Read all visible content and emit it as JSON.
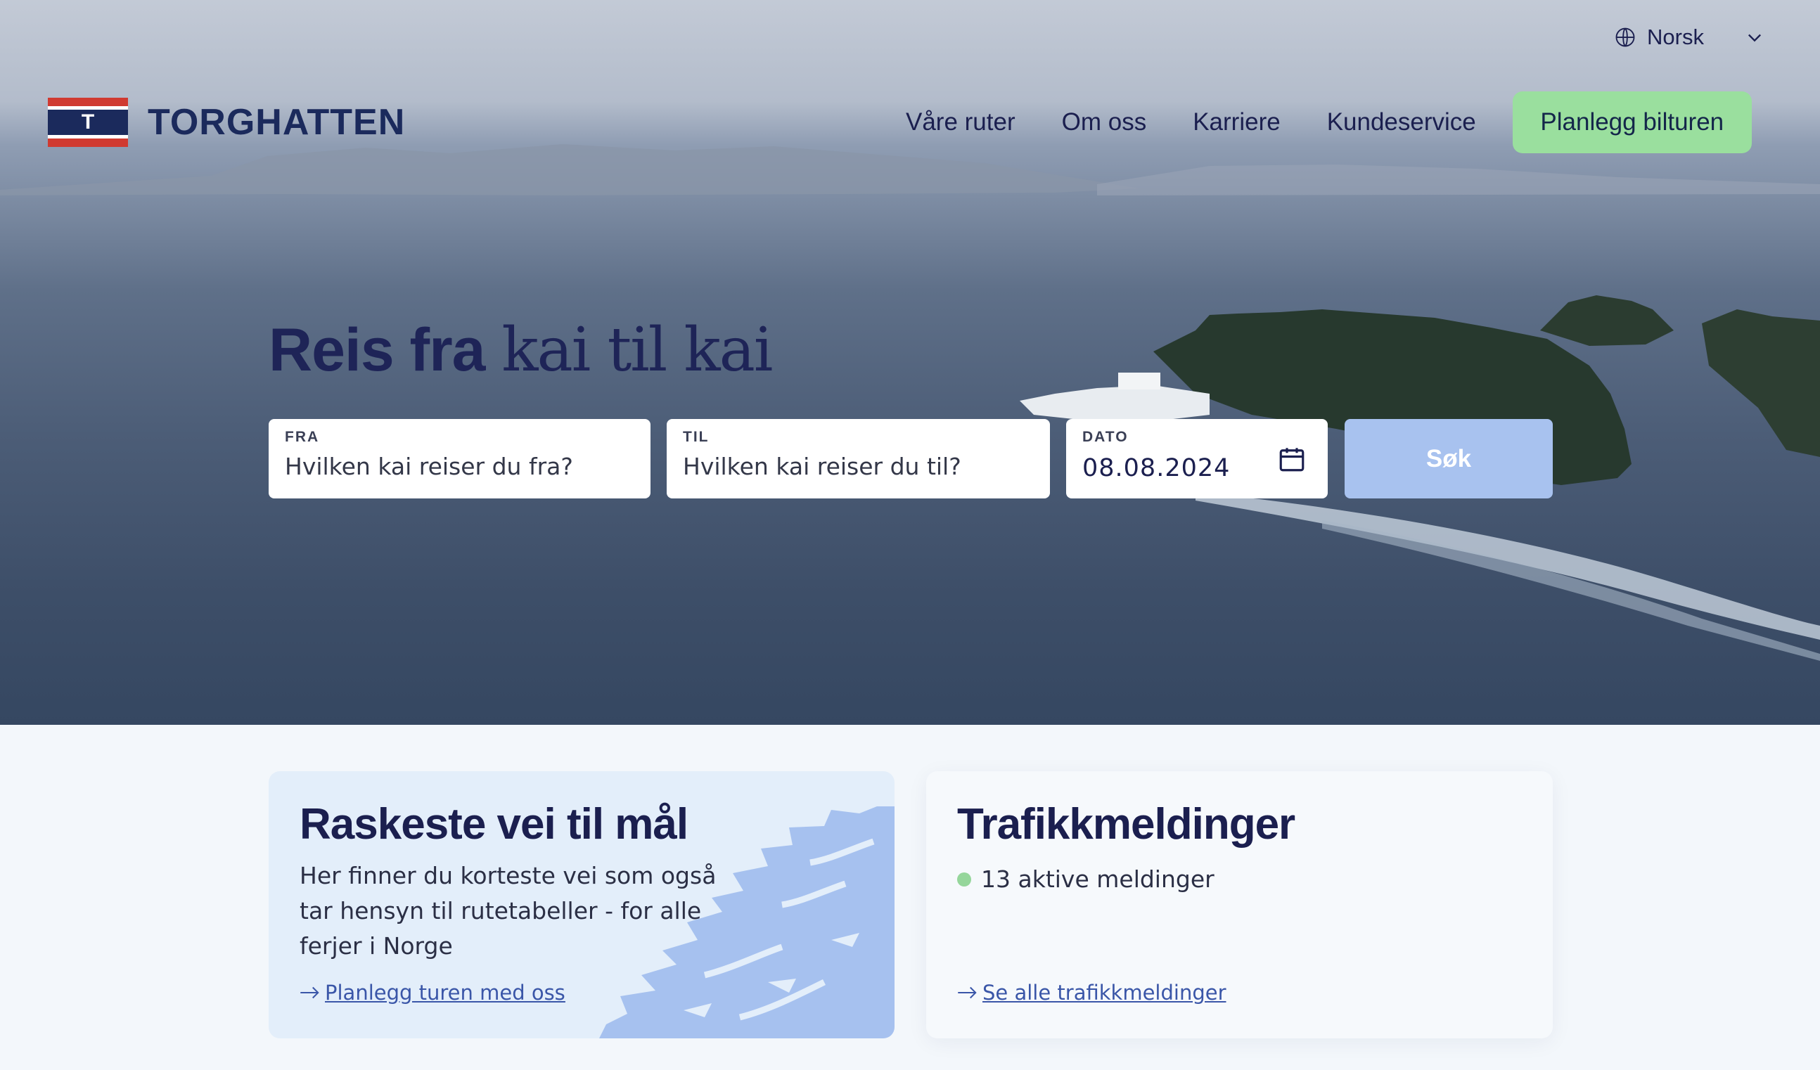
{
  "header": {
    "language": "Norsk",
    "brand": "TORGHATTEN",
    "brand_mark": "T",
    "nav": [
      "Våre ruter",
      "Om oss",
      "Karriere",
      "Kundeservice"
    ],
    "cta": "Planlegg bilturen"
  },
  "hero": {
    "headline_bold": "Reis fra",
    "headline_serif": "kai til kai"
  },
  "search": {
    "from_label": "FRA",
    "from_placeholder": "Hvilken kai reiser du fra?",
    "to_label": "TIL",
    "to_placeholder": "Hvilken kai reiser du til?",
    "date_label": "DATO",
    "date_value": "08.08.2024",
    "submit": "Søk"
  },
  "cards": {
    "route": {
      "title": "Raskeste vei til mål",
      "body": "Her finner du korteste vei som også tar hensyn til rutetabeller - for alle ferjer i Norge",
      "link": "Planlegg turen med oss"
    },
    "traffic": {
      "title": "Trafikkmeldinger",
      "status": "13 aktive meldinger",
      "link": "Se alle trafikkmeldinger"
    }
  },
  "colors": {
    "navy": "#1b1f4f",
    "cta_green": "#9adf9e",
    "search_button": "#a8c2ef",
    "status_dot": "#95d69b",
    "card_blue": "#e3eefa"
  },
  "icons": [
    "globe-icon",
    "chevron-down-icon",
    "calendar-icon",
    "arrow-right-icon",
    "map-illustration"
  ]
}
